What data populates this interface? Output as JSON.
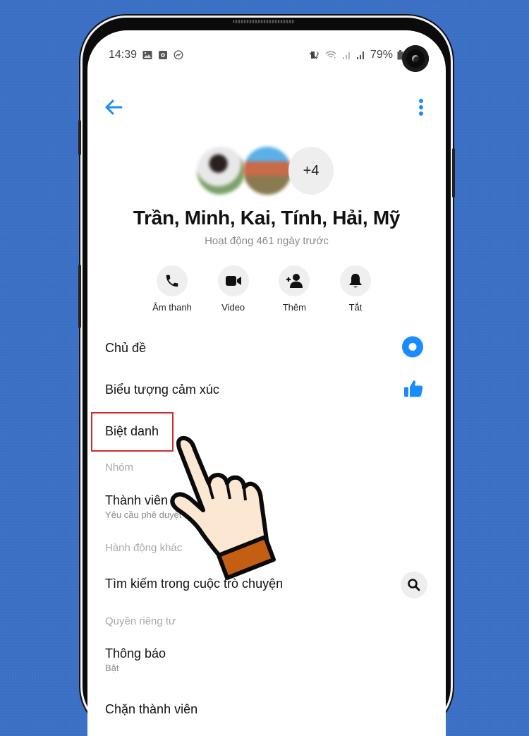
{
  "statusbar": {
    "time": "14:39",
    "battery": "79%",
    "icons_left": [
      "gallery-icon",
      "screen-record-icon",
      "messenger-icon"
    ],
    "icons_right": [
      "vibrate-icon",
      "wifi-icon",
      "signal-icon",
      "signal-icon",
      "battery-icon"
    ]
  },
  "header": {
    "back": "back-arrow-icon",
    "more": "more-vertical-icon",
    "accent": "#1a8cff"
  },
  "conversation": {
    "extra_members": "+4",
    "name": "Trần, Minh, Kai, Tính, Hải, Mỹ",
    "activity": "Hoạt động 461 ngày trước"
  },
  "actions": [
    {
      "label": "Âm thanh",
      "icon": "phone-icon"
    },
    {
      "label": "Video",
      "icon": "video-icon"
    },
    {
      "label": "Thêm",
      "icon": "add-person-icon"
    },
    {
      "label": "Tắt",
      "icon": "bell-icon"
    }
  ],
  "menu": {
    "theme": "Chủ đề",
    "emoji": "Biểu tượng cảm xúc",
    "nickname": "Biệt danh",
    "group_header": "Nhóm",
    "members": "Thành viên",
    "members_sub": "Yêu cầu phê duyệt đang chờ",
    "other_actions_header": "Hành động khác",
    "search": "Tìm kiếm trong cuộc trò chuyện",
    "privacy_header": "Quyền riêng tư",
    "notifications": "Thông báo",
    "notifications_sub": "Bật",
    "block": "Chặn thành viên"
  },
  "annotation": {
    "highlight_color": "#d42a2a",
    "pointer": "tap-hand-icon"
  }
}
